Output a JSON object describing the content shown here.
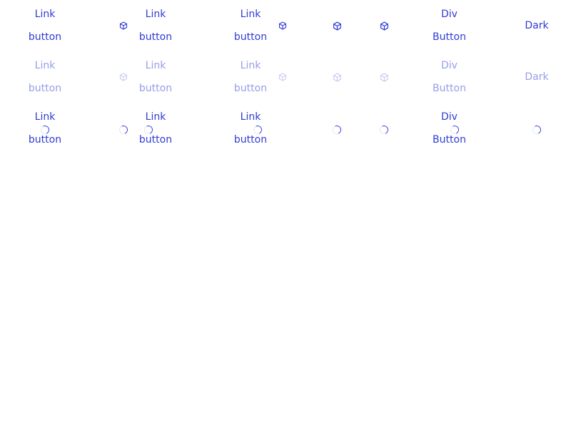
{
  "colors": {
    "accent": "#2f3bd4",
    "background": "#ffffff",
    "spinner_track": "#e4e6f2"
  },
  "rows": [
    {
      "state": "normal",
      "link_button": "Link\nbutton",
      "div_button": "Div\nButton",
      "dark": "Dark"
    },
    {
      "state": "disabled",
      "link_button": "Link\nbutton",
      "div_button": "Div\nButton",
      "dark": "Dark"
    },
    {
      "state": "loading",
      "link_button": "Link\nbutton",
      "div_button": "Div\nButton"
    }
  ],
  "icons": {
    "cube": "cube-icon",
    "spinner": "spinner-icon"
  }
}
